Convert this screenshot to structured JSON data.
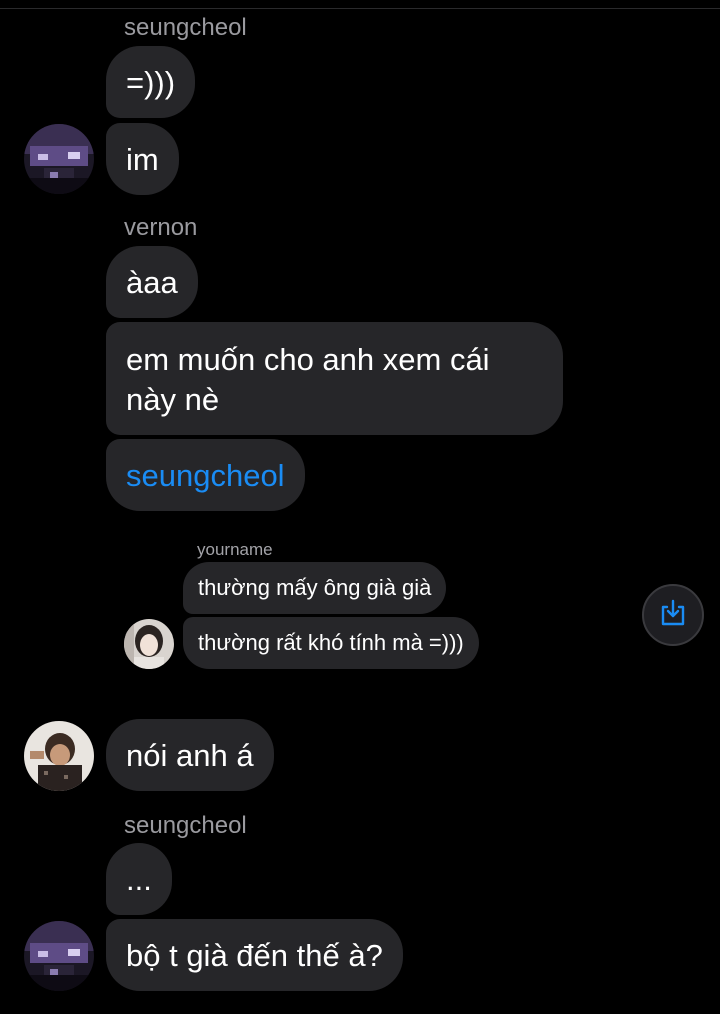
{
  "messages": {
    "group1_sender": "seungcheol",
    "m1": "=)))",
    "m2": "im",
    "group2_sender": "vernon",
    "m3": "àaa",
    "m4": "em muốn cho anh xem cái này nè",
    "m5_link": "seungcheol",
    "m6": "nói anh á",
    "group3_sender": "seungcheol",
    "m7": "...",
    "m8": "bộ t già đến thế à?"
  },
  "shared_post": {
    "sender": "yourname",
    "line1": "thường mấy ông già già",
    "line2": "thường rất khó tính mà =)))"
  },
  "icons": {
    "share": "share-download-icon",
    "share_color": "#1a8cf4"
  },
  "colors": {
    "background": "#000000",
    "bubble": "#262629",
    "link": "#1a8cf4",
    "sender_label": "#9a9a9f"
  }
}
